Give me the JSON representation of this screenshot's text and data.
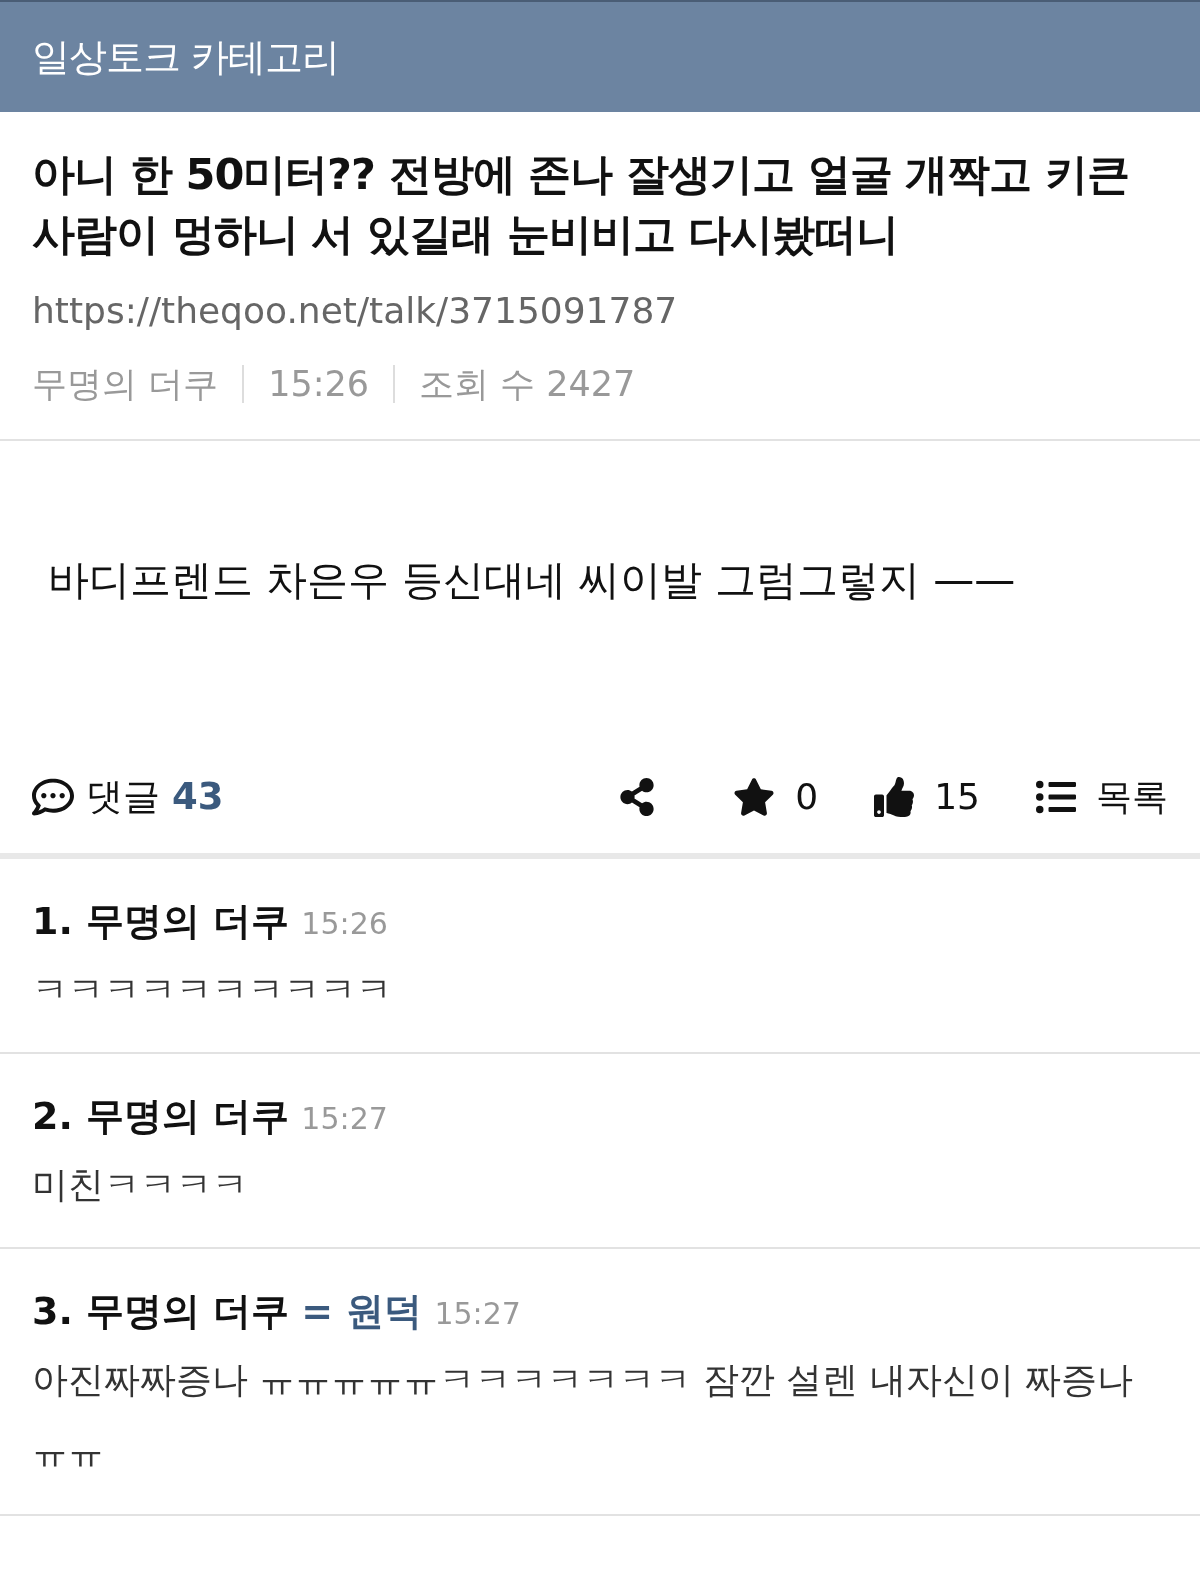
{
  "header": {
    "title": "일상토크 카테고리"
  },
  "post": {
    "title": "아니 한 50미터?? 전방에 존나 잘생기고 얼굴 개짝고 키큰 사람이 멍하니 서 있길래 눈비비고 다시봤떠니",
    "url": "https://theqoo.net/talk/3715091787",
    "author": "무명의 더쿠",
    "time": "15:26",
    "views": "조회 수 2427",
    "body": "바디프렌드 차은우 등신대네 씨이발 그럼그렇지 ——"
  },
  "actions": {
    "comments_label": "댓글",
    "comments_count": "43",
    "scrap_count": "0",
    "like_count": "15",
    "list_label": "목록"
  },
  "comments": [
    {
      "number": "1.",
      "author": "무명의 더쿠",
      "time": "15:26",
      "text": "ㅋㅋㅋㅋㅋㅋㅋㅋㅋㅋ"
    },
    {
      "number": "2.",
      "author": "무명의 더쿠",
      "time": "15:27",
      "text": "미친ㅋㅋㅋㅋ"
    },
    {
      "number": "3.",
      "author": "무명의 더쿠",
      "op_label": "= 원덕",
      "time": "15:27",
      "text": "아진짜짜증나 ㅠㅠㅠㅠㅠㅋㅋㅋㅋㅋㅋㅋ 잠깐 설렌 내자신이 짜증나 ㅠㅠ"
    }
  ]
}
